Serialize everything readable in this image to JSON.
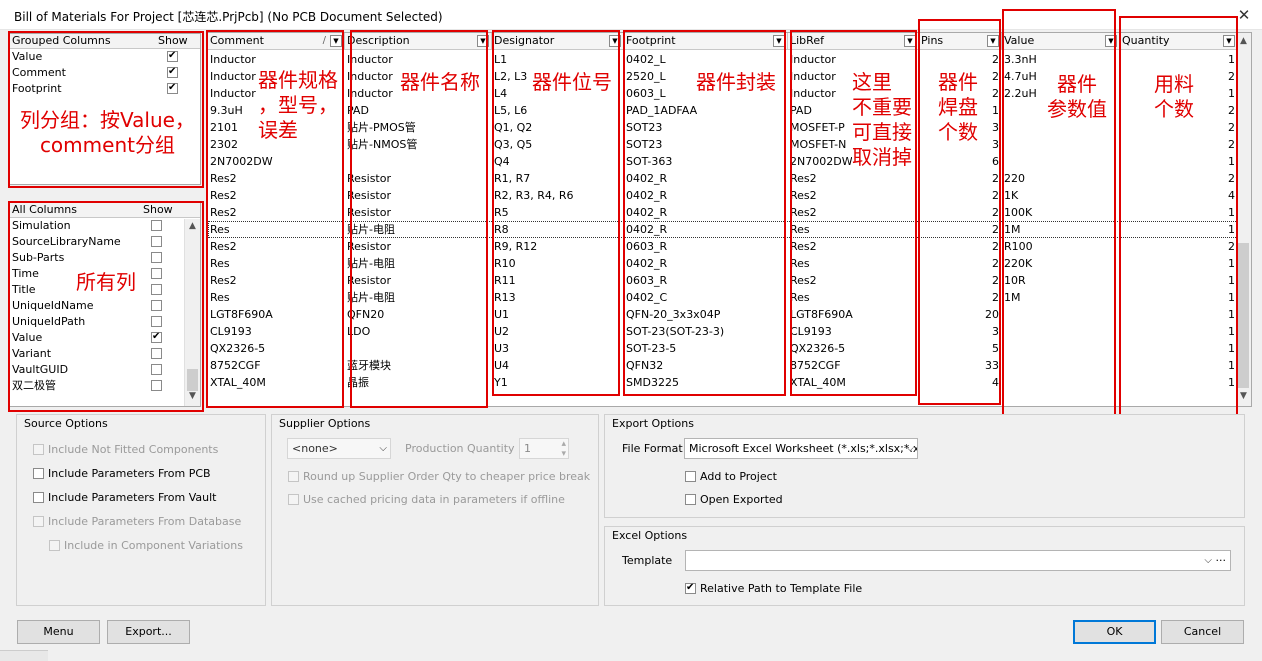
{
  "window": {
    "title": "Bill of Materials For Project [芯连芯.PrjPcb] (No PCB Document Selected)",
    "close_glyph": "✕"
  },
  "grouped_columns": {
    "header": "Grouped Columns",
    "show_header": "Show",
    "items": [
      {
        "label": "Value",
        "checked": true
      },
      {
        "label": "Comment",
        "checked": true
      },
      {
        "label": "Footprint",
        "checked": true
      }
    ]
  },
  "all_columns": {
    "header": "All Columns",
    "show_header": "Show",
    "items": [
      {
        "label": "Simulation",
        "checked": false
      },
      {
        "label": "SourceLibraryName",
        "checked": false
      },
      {
        "label": "Sub-Parts",
        "checked": false
      },
      {
        "label": "Time",
        "checked": false
      },
      {
        "label": "Title",
        "checked": false
      },
      {
        "label": "UniqueIdName",
        "checked": false
      },
      {
        "label": "UniqueIdPath",
        "checked": false
      },
      {
        "label": "Value",
        "checked": true
      },
      {
        "label": "Variant",
        "checked": false
      },
      {
        "label": "VaultGUID",
        "checked": false
      },
      {
        "label": "双二极管",
        "checked": false
      }
    ]
  },
  "table": {
    "columns": [
      "Comment",
      "Description",
      "Designator",
      "Footprint",
      "LibRef",
      "Pins",
      "Value",
      "Quantity"
    ],
    "rows": [
      [
        "Inductor",
        "Inductor",
        "L1",
        "0402_L",
        "Inductor",
        "2",
        "3.3nH",
        "1"
      ],
      [
        "Inductor",
        "Inductor",
        "L2, L3",
        "2520_L",
        "Inductor",
        "2",
        "4.7uH",
        "2"
      ],
      [
        "Inductor",
        "Inductor",
        "L4",
        "0603_L",
        "Inductor",
        "2",
        "2.2uH",
        "1"
      ],
      [
        "9.3uH",
        "PAD",
        "L5, L6",
        "PAD_1ADFAA",
        "PAD",
        "1",
        "",
        "2"
      ],
      [
        "2101",
        "贴片-PMOS管",
        "Q1, Q2",
        "SOT23",
        "MOSFET-P",
        "3",
        "",
        "2"
      ],
      [
        "2302",
        "贴片-NMOS管",
        "Q3, Q5",
        "SOT23",
        "MOSFET-N",
        "3",
        "",
        "2"
      ],
      [
        "2N7002DW",
        "",
        "Q4",
        "SOT-363",
        "2N7002DW",
        "6",
        "",
        "1"
      ],
      [
        "Res2",
        "Resistor",
        "R1, R7",
        "0402_R",
        "Res2",
        "2",
        "220",
        "2"
      ],
      [
        "Res2",
        "Resistor",
        "R2, R3, R4, R6",
        "0402_R",
        "Res2",
        "2",
        "1K",
        "4"
      ],
      [
        "Res2",
        "Resistor",
        "R5",
        "0402_R",
        "Res2",
        "2",
        "100K",
        "1"
      ],
      [
        "Res",
        "贴片-电阻",
        "R8",
        "0402_R",
        "Res",
        "2",
        "1M",
        "1"
      ],
      [
        "Res2",
        "Resistor",
        "R9, R12",
        "0603_R",
        "Res2",
        "2",
        "R100",
        "2"
      ],
      [
        "Res",
        "贴片-电阻",
        "R10",
        "0402_R",
        "Res",
        "2",
        "220K",
        "1"
      ],
      [
        "Res2",
        "Resistor",
        "R11",
        "0603_R",
        "Res2",
        "2",
        "10R",
        "1"
      ],
      [
        "Res",
        "贴片-电阻",
        "R13",
        "0402_C",
        "Res",
        "2",
        "1M",
        "1"
      ],
      [
        "LGT8F690A",
        "QFN20",
        "U1",
        "QFN-20_3x3x04P",
        "LGT8F690A",
        "20",
        "",
        "1"
      ],
      [
        "CL9193",
        "LDO",
        "U2",
        "SOT-23(SOT-23-3)",
        "CL9193",
        "3",
        "",
        "1"
      ],
      [
        "QX2326-5",
        "",
        "U3",
        "SOT-23-5",
        "QX2326-5",
        "5",
        "",
        "1"
      ],
      [
        "8752CGF",
        "蓝牙模块",
        "U4",
        "QFN32",
        "8752CGF",
        "33",
        "",
        "1"
      ],
      [
        "XTAL_40M",
        "晶振",
        "Y1",
        "SMD3225",
        "XTAL_40M",
        "4",
        "",
        "1"
      ]
    ]
  },
  "annotations": {
    "grouped": "列分组：按Value，\ncomment分组",
    "all_columns": "所有列",
    "comment": "器件规格\n，型号，\n误差",
    "description": "器件名称",
    "designator": "器件位号",
    "footprint": "器件封装",
    "libref": "这里\n不重要\n可直接\n取消掉",
    "pins": "器件\n焊盘\n个数",
    "value": "器件\n参数值",
    "quantity": "用料\n个数"
  },
  "source_options": {
    "title": "Source Options",
    "items": [
      {
        "label": "Include Not Fitted Components",
        "checked": false,
        "enabled": false
      },
      {
        "label": "Include Parameters From PCB",
        "checked": false,
        "enabled": true
      },
      {
        "label": "Include Parameters From Vault",
        "checked": false,
        "enabled": true
      },
      {
        "label": "Include Parameters From Database",
        "checked": false,
        "enabled": false
      },
      {
        "label": "Include in Component Variations",
        "checked": false,
        "enabled": false
      }
    ]
  },
  "supplier_options": {
    "title": "Supplier Options",
    "supplier_value": "<none>",
    "production_quantity_label": "Production Quantity",
    "production_quantity_value": "1",
    "round_up_label": "Round up Supplier Order Qty to cheaper price break",
    "cached_label": "Use cached pricing data in parameters if offline"
  },
  "export_options": {
    "title": "Export Options",
    "file_format_label": "File Format",
    "file_format_value": "Microsoft Excel Worksheet (*.xls;*.xlsx;*.x",
    "add_to_project": "Add to Project",
    "open_exported": "Open Exported"
  },
  "excel_options": {
    "title": "Excel Options",
    "template_label": "Template",
    "template_value": "",
    "relative_path_label": "Relative Path to Template File",
    "relative_path_checked": true
  },
  "buttons": {
    "menu": "Menu",
    "export": "Export...",
    "ok": "OK",
    "cancel": "Cancel"
  },
  "colors": {
    "annotation_red": "#e00000",
    "primary_border": "#0078d7"
  }
}
